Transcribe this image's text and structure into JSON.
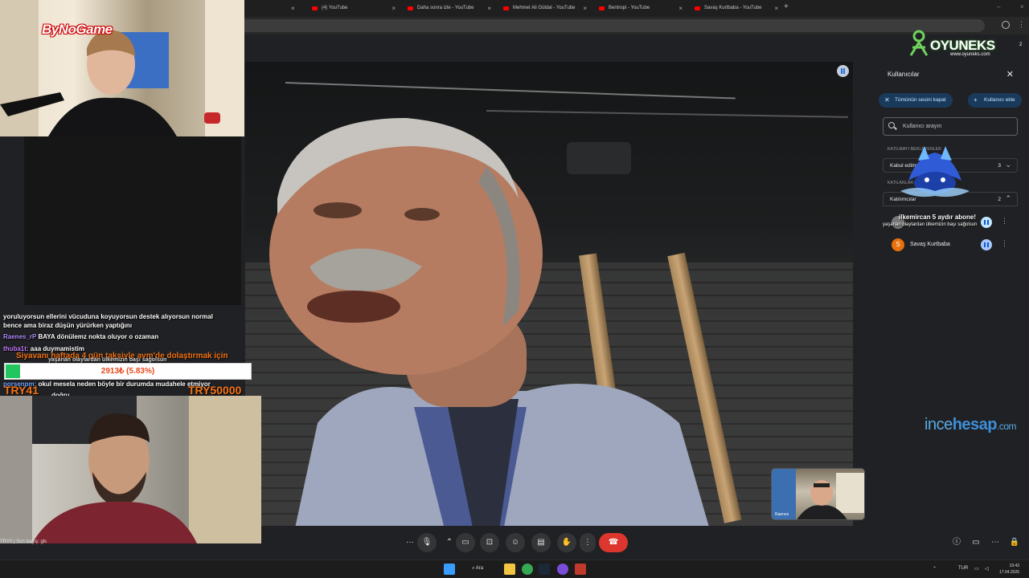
{
  "browser": {
    "tabs": [
      {
        "label": "(4) YouTube"
      },
      {
        "label": "Daha sonra izle - YouTube"
      },
      {
        "label": "Mehmet Ali Güldal - YouTube"
      },
      {
        "label": "Bentropi - YouTube"
      },
      {
        "label": "Savaş Kurtbaba - YouTube"
      }
    ],
    "new_tab": "+"
  },
  "stream_overlay": {
    "logo_text": "ByNoGame",
    "chat": [
      {
        "text": "yoruluyorsun ellerini vücuduna koyuyorsun destek alıyorsun normal"
      },
      {
        "text": "bence ama biraz düşün yürürken yaptığını"
      },
      {
        "user": "Raenes_rP",
        "text": "BAYA dönülemz nokta oluyor o ozaman"
      },
      {
        "user": "thuba1t:",
        "text": "aaa duymamistim"
      },
      {
        "user": "porsenpm:",
        "text": "okul mesela neden böyle bir durumda mudahele etmiyor"
      },
      {
        "text": "doğru"
      }
    ],
    "announcement": "Siyavanı haftada 4 gün taksiyle avm'de dolaştırmak için",
    "announcement_sub": "yaşanan olaylardan ülkemizin başı sağolsun",
    "goal": {
      "text": "2913₺ (5.83%)",
      "progress": 0.0583,
      "left_label": "TRY41",
      "right_label": "TRY50000"
    },
    "bottom_text": "TRY0 | Son bağış: gls"
  },
  "meet": {
    "self_name": "Raenes",
    "panel": {
      "title": "Kullanıcılar",
      "mute_all": "Tümünün sesini kapat",
      "add_user": "Kullanıcı ekle",
      "search_placeholder": "Kullanıcı arayın",
      "section_waiting": "KATILMAYI BEKLEYENLER",
      "waiting_group": {
        "label": "Kabul edilmeyi bekleyenler",
        "count": "3"
      },
      "section_in_call": "KATILANLAR",
      "in_call_group": {
        "label": "Katılımcılar",
        "count": "2"
      },
      "participants": [
        {
          "initial": "S",
          "name": "Savaş Kurtbaba",
          "color": "#e8710a"
        }
      ]
    },
    "sub_alert": {
      "line1": "ilkemircan 5 aydır abone!",
      "line2": "yaşanan olaylardan ülkemizin başı sağolsun"
    }
  },
  "brands": {
    "top_name": "OYUNEKS",
    "top_url": "www.oyuneks.com",
    "top_badge": "2",
    "right_a": "ince",
    "right_b": "hesap",
    "right_c": ".com"
  },
  "taskbar": {
    "search_label": "Ara",
    "lang": "TUR",
    "time": "19:43",
    "date": "17.04.2026"
  },
  "colors": {
    "end_call": "#dc362e",
    "accent_blue": "#a8c7fa",
    "donation_orange": "#f47316"
  }
}
